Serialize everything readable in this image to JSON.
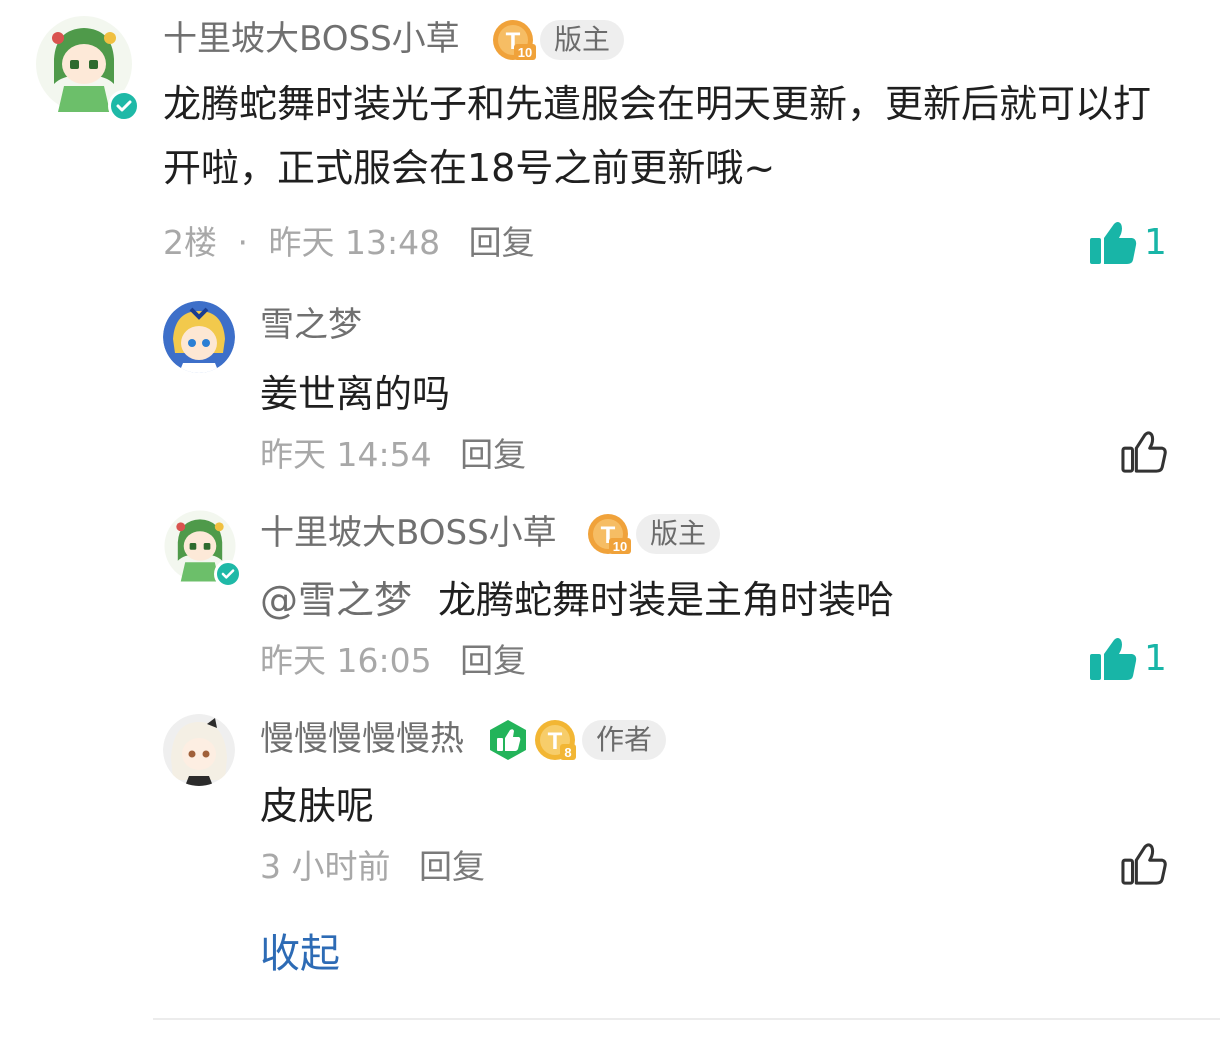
{
  "thread": {
    "main_comment": {
      "author": "十里坡大BOSS小草",
      "level_badge": {
        "letter": "T",
        "level": "10"
      },
      "role": "版主",
      "content": "龙腾蛇舞时装光子和先遣服会在明天更新，更新后就可以打开啦，正式服会在18号之前更新哦~",
      "floor": "2楼",
      "separator": "·",
      "time": "昨天 13:48",
      "reply_label": "回复",
      "likes": "1",
      "liked": true
    },
    "replies": [
      {
        "author": "雪之梦",
        "content": "姜世离的吗",
        "time": "昨天 14:54",
        "reply_label": "回复",
        "liked": false
      },
      {
        "author": "十里坡大BOSS小草",
        "level_badge": {
          "letter": "T",
          "level": "10"
        },
        "role": "版主",
        "mention": "@雪之梦",
        "content": "龙腾蛇舞时装是主角时装哈",
        "time": "昨天 16:05",
        "reply_label": "回复",
        "likes": "1",
        "liked": true
      },
      {
        "author": "慢慢慢慢慢热",
        "level_badge": {
          "letter": "T",
          "level": "8"
        },
        "role": "作者",
        "content": "皮肤呢",
        "time": "3 小时前",
        "reply_label": "回复",
        "liked": false
      }
    ],
    "collapse_label": "收起"
  },
  "colors": {
    "accent_teal": "#18b5a7",
    "link_blue": "#2d6bb5",
    "badge_orange": "#f0a23a",
    "badge_gold": "#f2b634",
    "badge_green": "#23b45a"
  },
  "icons": [
    "thumbs-up-filled-icon",
    "thumbs-up-outline-icon",
    "verified-icon",
    "level-badge-icon",
    "like-medal-icon"
  ]
}
